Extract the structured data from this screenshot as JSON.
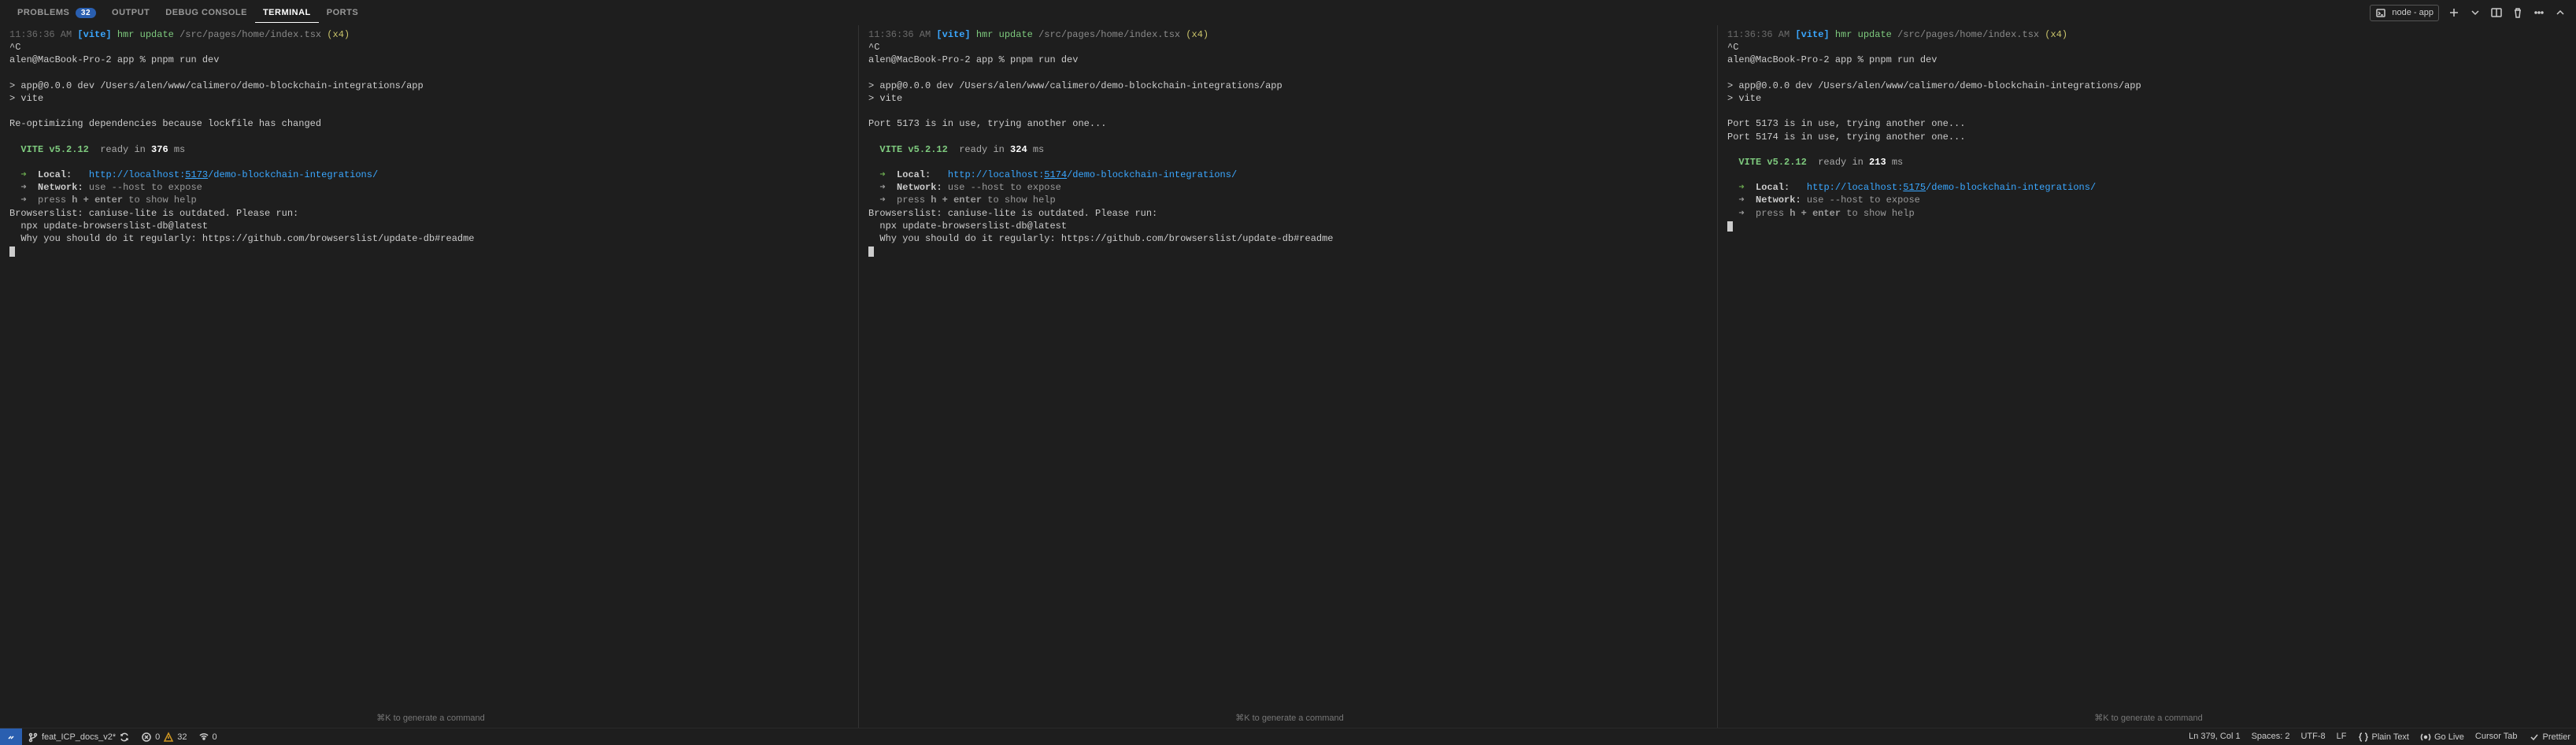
{
  "tabs": {
    "problems": "PROBLEMS",
    "problems_badge": "32",
    "output": "OUTPUT",
    "debug": "DEBUG CONSOLE",
    "terminal": "TERMINAL",
    "ports": "PORTS"
  },
  "header_right": {
    "terminal_name": "node - app"
  },
  "shared": {
    "timestamp": "11:36:36 AM",
    "vite_tag": "[vite]",
    "hmr": "hmr update",
    "hmr_path": "/src/pages/home/index.tsx",
    "hmr_mult": "(x4)",
    "ctrlc": "^C",
    "prompt": "alen@MacBook-Pro-2 app % pnpm run dev",
    "vite_ver": "VITE v5.2.12",
    "ready": "ready in",
    "ms": "ms",
    "arrow": "➜",
    "local_lbl": "Local:",
    "network_lbl": "Network:",
    "network_hint": "use --host to expose",
    "help_prefix": "press",
    "help_keys": "h + enter",
    "help_suffix": "to show help",
    "browserslist1": "Browserslist: caniuse-lite is outdated. Please run:",
    "browserslist2": "  npx update-browserslist-db@latest",
    "browserslist3_a": "  Why you should do it regularly: ",
    "browserslist3_b": "https://github.com/browserslist/update-db#readme",
    "hint": "⌘K to generate a command"
  },
  "pane1": {
    "run1": "> app@0.0.0 dev /Users/alen/www/calimero/demo-blockchain-integrations/app",
    "run2": "> vite",
    "reopt": "Re-optimizing dependencies because lockfile has changed",
    "ready_ms": "376",
    "local_url_a": "http://localhost:",
    "local_url_port": "5173",
    "local_url_b": "/demo-blockchain-integrations/"
  },
  "pane2": {
    "run1": "> app@0.0.0 dev /Users/alen/www/calimero/demo-blockchain-integrations/app",
    "run2": "> vite",
    "port_msg": "Port 5173 is in use, trying another one...",
    "ready_ms": "324",
    "local_url_a": "http://localhost:",
    "local_url_port": "5174",
    "local_url_b": "/demo-blockchain-integrations/"
  },
  "pane3": {
    "run1": "> app@0.0.0 dev /Users/alen/www/calimero/demo-blockchain-integrations/app",
    "run2": "> vite",
    "port_msg1": "Port 5173 is in use, trying another one...",
    "port_msg2": "Port 5174 is in use, trying another one...",
    "ready_ms": "213",
    "local_url_a": "http://localhost:",
    "local_url_port": "5175",
    "local_url_b": "/demo-blockchain-integrations/"
  },
  "statusbar": {
    "branch": "feat_ICP_docs_v2*",
    "errors": "0",
    "warnings": "32",
    "ports": "0",
    "lncol": "Ln 379, Col 1",
    "spaces": "Spaces: 2",
    "encoding": "UTF-8",
    "eol": "LF",
    "lang": "Plain Text",
    "golive": "Go Live",
    "cursortab": "Cursor Tab",
    "prettier": "Prettier"
  }
}
